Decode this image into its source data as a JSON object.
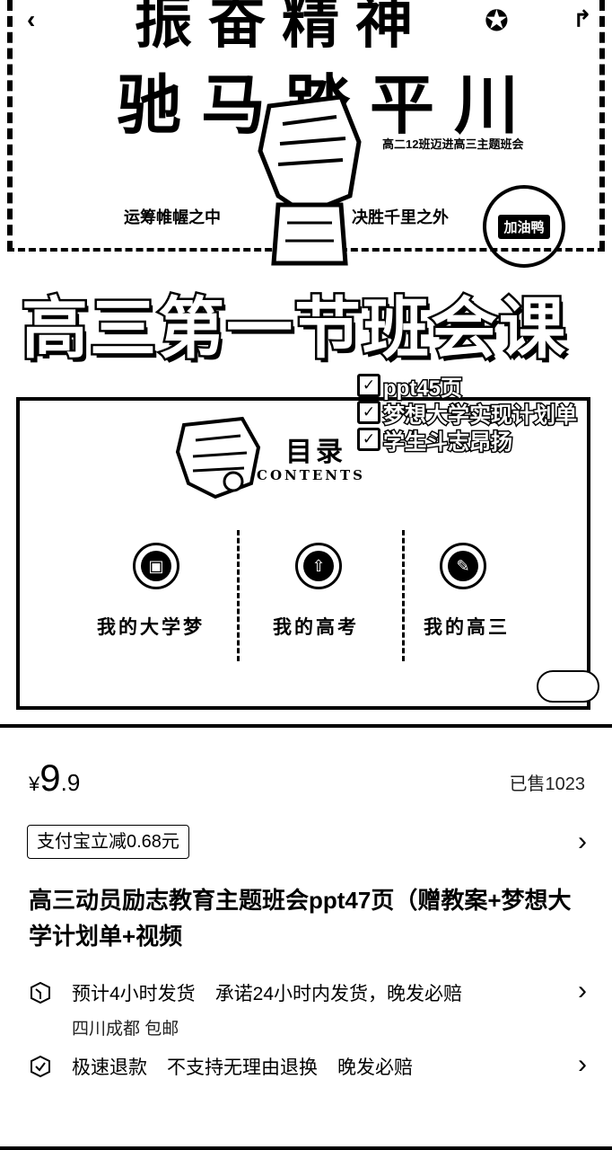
{
  "hero": {
    "slide_top_text": "振奋精神",
    "slide_headline": "驰马踏平川",
    "slide_subtitle": "高二12班迈进高三主题班会",
    "slogan_left": "运筹帷幄之中",
    "slogan_right": "决胜千里之外",
    "seal_text": "加油鸭",
    "big_title": "高三第一节班会课",
    "features": [
      {
        "label": "ppt45页"
      },
      {
        "label": "梦想大学实现计划单"
      },
      {
        "label": "学生斗志昂扬"
      }
    ],
    "contents_title": "目录",
    "contents_en": "CONTENTS",
    "categories": [
      {
        "label": "我的大学梦",
        "icon": "cube-icon"
      },
      {
        "label": "我的高考",
        "icon": "cloud-upload-icon"
      },
      {
        "label": "我的高三",
        "icon": "edit-icon"
      }
    ]
  },
  "product": {
    "currency": "¥",
    "price_int": "9",
    "price_dec": ".9",
    "sold": "已售1023",
    "promo": "支付宝立减0.68元",
    "title": "高三动员励志教育主题班会ppt47页（赠教案+梦想大学计划单+视频",
    "shipping_estimate": "预计4小时发货",
    "shipping_promise": "承诺24小时内发货，晚发必赔",
    "shipping_from": "四川成都 包邮",
    "refund_fast": "极速退款",
    "refund_policy": "不支持无理由退换",
    "refund_late": "晚发必赔"
  }
}
